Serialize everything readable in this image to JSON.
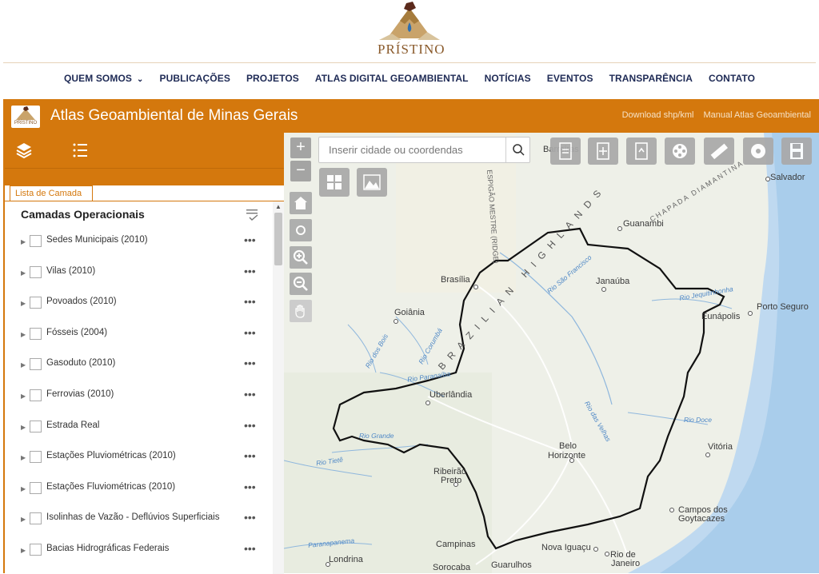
{
  "site": {
    "brand": "PRÍSTINO",
    "nav": [
      {
        "label": "QUEM SOMOS",
        "has_dropdown": true
      },
      {
        "label": "PUBLICAÇÕES"
      },
      {
        "label": "PROJETOS"
      },
      {
        "label": "ATLAS DIGITAL GEOAMBIENTAL"
      },
      {
        "label": "NOTÍCIAS"
      },
      {
        "label": "EVENTOS"
      },
      {
        "label": "TRANSPARÊNCIA"
      },
      {
        "label": "CONTATO"
      }
    ]
  },
  "app": {
    "title": "Atlas Geoambiental de Minas Gerais",
    "logo_text": "PRÍSTINO",
    "links": [
      "Download shp/kml",
      "Manual Atlas Geoambiental"
    ]
  },
  "panel": {
    "tab": "Lista de Camada",
    "heading": "Camadas Operacionais",
    "layers": [
      {
        "label": "Sedes Municipais (2010)",
        "checked": false
      },
      {
        "label": "Vilas (2010)",
        "checked": false
      },
      {
        "label": "Povoados (2010)",
        "checked": false
      },
      {
        "label": "Fósseis (2004)",
        "checked": false
      },
      {
        "label": "Gasoduto (2010)",
        "checked": false
      },
      {
        "label": "Ferrovias (2010)",
        "checked": false
      },
      {
        "label": "Estrada Real",
        "checked": false
      },
      {
        "label": "Estações Pluviométricas (2010)",
        "checked": false
      },
      {
        "label": "Estações Fluviométricas (2010)",
        "checked": false
      },
      {
        "label": "Isolinhas de Vazão - Deflúvios Superficiais",
        "checked": false
      },
      {
        "label": "Bacias Hidrográficas Federais",
        "checked": false
      }
    ],
    "more_glyph": "•••"
  },
  "map": {
    "search_placeholder": "Inserir cidade ou coordendas",
    "zoom_in": "+",
    "zoom_out": "−",
    "places": {
      "brasilia": "Brasília",
      "goiania": "Goiânia",
      "uberlandia": "Uberlândia",
      "guanambi": "Guanambi",
      "janauba": "Janaúba",
      "salvador": "Salvador",
      "porto_seguro": "Porto Seguro",
      "eunapolis": "Eunápolis",
      "belo_horizonte_1": "Belo",
      "belo_horizonte_2": "Horizonte",
      "vitoria": "Vitória",
      "ribeirao_1": "Ribeirão",
      "ribeirao_2": "Preto",
      "campos_1": "Campos dos",
      "campos_2": "Goytacazes",
      "campinas": "Campinas",
      "nova_iguacu": "Nova Iguaçu",
      "rio_1": "Rio de",
      "rio_2": "Janeiro",
      "londrina": "Londrina",
      "sorocaba": "Sorocaba",
      "guarulhos": "Guarulhos",
      "barreiras": "Barreiras"
    },
    "rivers": {
      "sao_francisco": "Rio São Francisco",
      "jequitinhonha": "Rio Jequitinhonha",
      "paranaiba": "Rio Paranaíba",
      "grande": "Rio Grande",
      "tiete": "Rio Tietê",
      "corumba": "Rio Corumbá",
      "dos_bois": "Rio dos Bois",
      "das_velhas": "Rio das Velhas",
      "doce": "Rio Doce",
      "paranapanema": "Paranapanema"
    },
    "regions": {
      "brazilian_highlands": "BRAZILIAN HIGHLANDS",
      "espigao": "ESPIGÃO MESTRE (RIDGE)",
      "chapada": "CHAPADA DIAMANTINA"
    }
  }
}
